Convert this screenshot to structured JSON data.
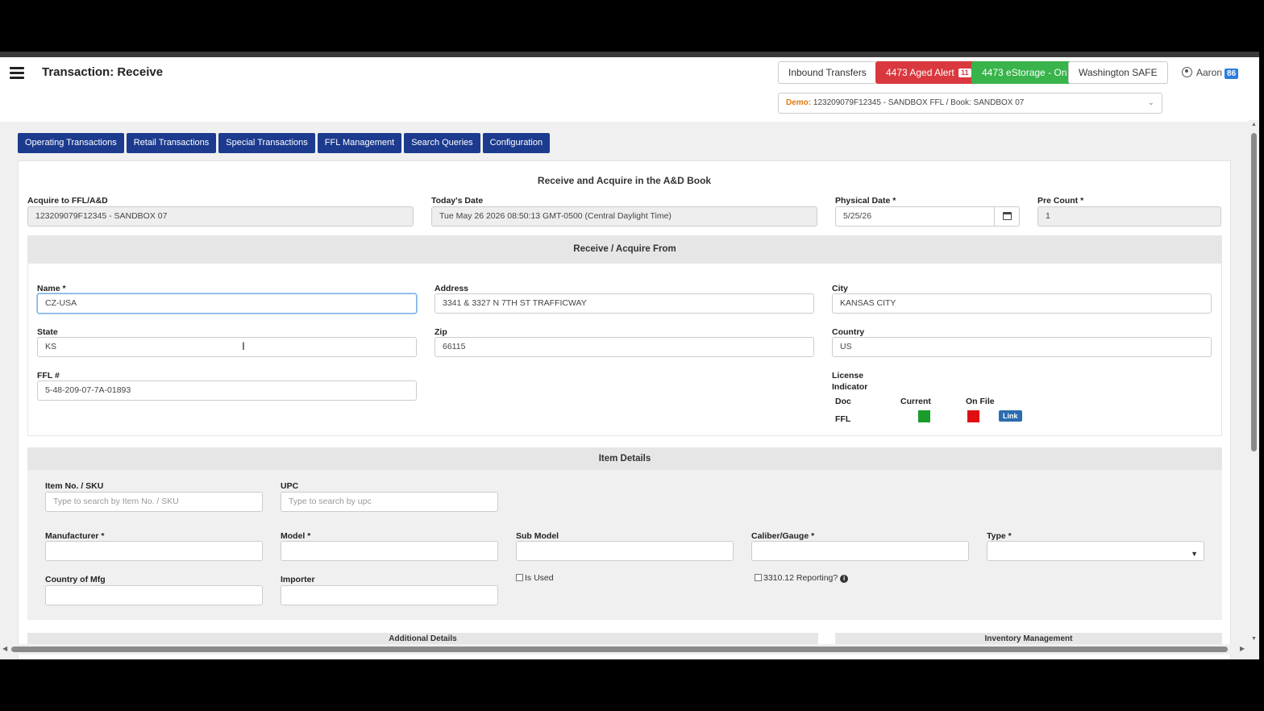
{
  "header": {
    "title": "Transaction: Receive",
    "buttons": {
      "inbound": "Inbound Transfers",
      "aged_alert": "4473 Aged Alert",
      "aged_alert_count": "11",
      "estorage": "4473 eStorage - On",
      "safe": "Washington SAFE"
    },
    "book": {
      "prefix": "Demo:",
      "value": "123209079F12345 - SANDBOX FFL / Book: SANDBOX 07"
    },
    "user": {
      "name": "Aaron",
      "badge": "86"
    }
  },
  "nav": [
    "Operating Transactions",
    "Retail Transactions",
    "Special Transactions",
    "FFL Management",
    "Search Queries",
    "Configuration"
  ],
  "form": {
    "title": "Receive and Acquire in the A&D Book",
    "acquire_label": "Acquire to FFL/A&D",
    "acquire_value": "123209079F12345 - SANDBOX 07",
    "today_label": "Today's Date",
    "today_value": "Tue May 26 2026 08:50:13 GMT-0500 (Central Daylight Time)",
    "physical_label": "Physical Date *",
    "physical_value": "5/25/26",
    "precount_label": "Pre Count *",
    "precount_value": "1"
  },
  "receive": {
    "title": "Receive / Acquire From",
    "name_label": "Name *",
    "name_value": "CZ-USA",
    "address_label": "Address",
    "address_value": "3341 & 3327 N 7TH ST TRAFFICWAY",
    "city_label": "City",
    "city_value": "KANSAS CITY",
    "state_label": "State",
    "state_value": "KS",
    "zip_label": "Zip",
    "zip_value": "66115",
    "country_label": "Country",
    "country_value": "US",
    "ffl_label": "FFL #",
    "ffl_value": "5-48-209-07-7A-01893",
    "license": {
      "label_line1": "License",
      "label_line2": "Indicator",
      "doc_header": "Doc",
      "current_header": "Current",
      "onfile_header": "On File",
      "row_doc": "FFL",
      "current_color": "#1a9c2a",
      "onfile_color": "#e01010",
      "link_label": "Link"
    }
  },
  "items": {
    "title": "Item Details",
    "sku_label": "Item No. / SKU",
    "sku_placeholder": "Type to search by Item No. / SKU",
    "upc_label": "UPC",
    "upc_placeholder": "Type to search by upc",
    "manufacturer_label": "Manufacturer *",
    "model_label": "Model *",
    "submodel_label": "Sub Model",
    "caliber_label": "Caliber/Gauge *",
    "type_label": "Type *",
    "country_mfg_label": "Country of Mfg",
    "importer_label": "Importer",
    "is_used_label": "Is Used",
    "reporting_label": "3310.12 Reporting?"
  },
  "bottom": {
    "additional_title": "Additional Details",
    "inventory_title": "Inventory Management"
  }
}
